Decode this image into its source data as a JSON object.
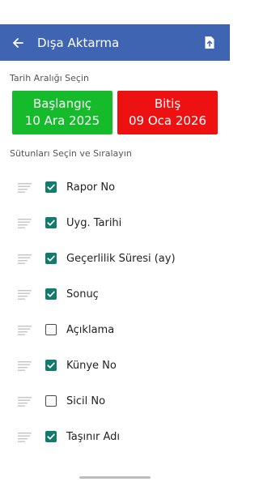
{
  "appbar": {
    "title": "Dışa Aktarma",
    "color": "#3f64b1",
    "back_icon": "arrow-left",
    "export_icon": "file-upload"
  },
  "date_range": {
    "label": "Tarih Aralığı Seçin",
    "start": {
      "title": "Başlangıç",
      "date": "10 Ara 2025",
      "color": "#16bb2c"
    },
    "end": {
      "title": "Bitiş",
      "date": "09 Oca 2026",
      "color": "#ee1111"
    }
  },
  "columns": {
    "label": "Sütunları Seçin ve Sıralayın",
    "items": [
      {
        "label": "Rapor No",
        "checked": true
      },
      {
        "label": "Uyg. Tarihi",
        "checked": true
      },
      {
        "label": "Geçerlilik Süresi (ay)",
        "checked": true
      },
      {
        "label": "Sonuç",
        "checked": true
      },
      {
        "label": "Açıklama",
        "checked": false
      },
      {
        "label": "Künye No",
        "checked": true
      },
      {
        "label": "Sicil No",
        "checked": false
      },
      {
        "label": "Taşınır Adı",
        "checked": true
      }
    ]
  }
}
